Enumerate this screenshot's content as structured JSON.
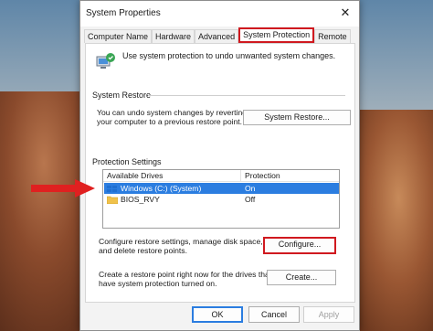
{
  "window": {
    "title": "System Properties"
  },
  "tabs": [
    {
      "label": "Computer Name"
    },
    {
      "label": "Hardware"
    },
    {
      "label": "Advanced"
    },
    {
      "label": "System Protection",
      "active": true
    },
    {
      "label": "Remote"
    }
  ],
  "intro": {
    "text": "Use system protection to undo unwanted system changes."
  },
  "system_restore": {
    "title": "System Restore",
    "description_line1": "You can undo system changes by reverting",
    "description_line2": "your computer to a previous restore point.",
    "button_label": "System Restore..."
  },
  "protection_settings": {
    "title": "Protection Settings",
    "columns": [
      "Available Drives",
      "Protection"
    ],
    "drives": [
      {
        "name": "Windows (C:) (System)",
        "protection": "On",
        "selected": true
      },
      {
        "name": "BIOS_RVY",
        "protection": "Off",
        "selected": false
      }
    ],
    "configure_text_line1": "Configure restore settings, manage disk space,",
    "configure_text_line2": "and delete restore points.",
    "configure_label": "Configure...",
    "create_text_line1": "Create a restore point right now for the drives that",
    "create_text_line2": "have system protection turned on.",
    "create_label": "Create..."
  },
  "footer": {
    "ok": "OK",
    "cancel": "Cancel",
    "apply": "Apply"
  },
  "colors": {
    "highlight_red": "#d0191f",
    "selection_blue": "#2b7de0",
    "arrow_red": "#e02020"
  },
  "icons": {
    "close": "close-icon",
    "shield": "system-protection-icon",
    "drive": "drive-icon",
    "arrow": "red-arrow-annotation"
  }
}
